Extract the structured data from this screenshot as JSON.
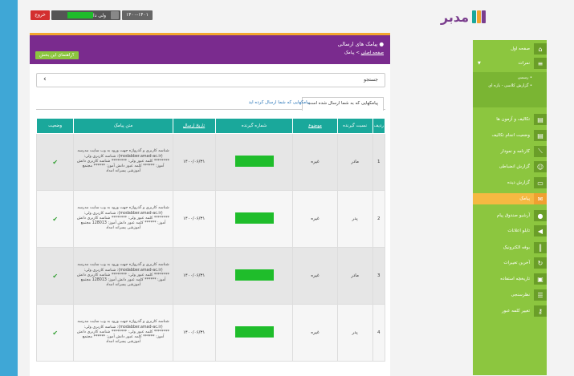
{
  "header": {
    "logout_label": "خروج",
    "user_label": "ولی دانش آموز",
    "year_label": "۱۴۰۰-۱۴۰۱",
    "brand_name": "مدبر"
  },
  "sidebar": {
    "items": [
      {
        "label": "صفحه اول",
        "icon": "home-icon"
      },
      {
        "label": "نمرات",
        "icon": "list-icon"
      },
      {
        "label": "تکالیف و آزمون ها",
        "icon": "book-icon"
      },
      {
        "label": "وضعیت انجام تکالیف",
        "icon": "book-icon"
      },
      {
        "label": "کارنامه و نمودار",
        "icon": "chart-icon"
      },
      {
        "label": "گزارش انضباطی",
        "icon": "people-icon"
      },
      {
        "label": "گزارش دیده",
        "icon": "card-icon"
      },
      {
        "label": "پیامک",
        "icon": "mail-icon"
      },
      {
        "label": "آرشیو صندوق پیام",
        "icon": "chat-icon"
      },
      {
        "label": "تابلو اعلانات",
        "icon": "megaphone-icon"
      },
      {
        "label": "بوفه الکترونیک",
        "icon": "barcode-icon"
      },
      {
        "label": "آخرین تغییرات",
        "icon": "refresh-icon"
      },
      {
        "label": "تاریخچه استفاده",
        "icon": "box-icon"
      },
      {
        "label": "نظرسنجی",
        "icon": "list-icon"
      },
      {
        "label": "تغییر کلمه عبور",
        "icon": "key-icon"
      }
    ],
    "sub_items": [
      "رسمی",
      "گزارش کلاسی - بازه ای"
    ]
  },
  "page": {
    "title": "پیامک های ارسالی",
    "breadcrumb_home": "صفحه اصلی",
    "breadcrumb_current": "پیامک",
    "help_label": "راهنمای این بخش",
    "search_label": "جستجو"
  },
  "tabs": [
    "پیامکهایی که به شما ارسال شده است",
    "پیامکهایی که شما ارسال کرده اید"
  ],
  "table": {
    "headers": [
      "ردیف",
      "نسبت گیرنده",
      "موضوع",
      "شماره گیرنده",
      "تاریخ ارسال",
      "متن پیامک",
      "وضعیت"
    ],
    "rows": [
      {
        "num": "1",
        "relation": "مادر",
        "subject": "غیره",
        "date": "۱۴۰۰/۰۶/۳۱",
        "text": "شناسه کاربری و گذرواژه جهت ورود به وب سایت مدرسه (modabber.amad-ac.ir): شناسه کاربری ولی: ******** کلمه عبور ولی: ******** شناسه کاربری دانش آموز: ****** کلمه عبور دانش آموز: ****** مجتمع آموزشی پسرانه امداد"
      },
      {
        "num": "2",
        "relation": "پدر",
        "subject": "غیره",
        "date": "۱۴۰۰/۰۶/۳۱",
        "text": "شناسه کاربری و گذرواژه جهت ورود به وب سایت مدرسه (modabber.amad-ac.ir): شناسه کاربری ولی: ******** کلمه عبور ولی: ******** شناسه کاربری دانش آموز: ****** کلمه عبور دانش آموز: 128013 مجتمع آموزشی پسرانه امداد"
      },
      {
        "num": "3",
        "relation": "مادر",
        "subject": "غیره",
        "date": "۱۴۰۰/۰۶/۳۱",
        "text": "شناسه کاربری و گذرواژه جهت ورود به وب سایت مدرسه (modabber.amad-ac.ir): شناسه کاربری ولی: ******** کلمه عبور ولی: ******** شناسه کاربری دانش آموز: ****** کلمه عبور دانش آموز: 128013 مجتمع آموزشی پسرانه امداد"
      },
      {
        "num": "4",
        "relation": "پدر",
        "subject": "غیره",
        "date": "۱۴۰۰/۰۶/۳۱",
        "text": "شناسه کاربری و گذرواژه جهت ورود به وب سایت مدرسه (modabber.amad-ac.ir): شناسه کاربری ولی: ******** کلمه عبور ولی: ******** شناسه کاربری دانش آموز: ****** کلمه عبور دانش آموز: ****** مجتمع آموزشی پسرانه امداد"
      }
    ]
  },
  "colors": {
    "sidebar": "#8cc63f",
    "header": "#7a2b8e",
    "table_head": "#1aa89b",
    "accent": "#f2a62e"
  }
}
